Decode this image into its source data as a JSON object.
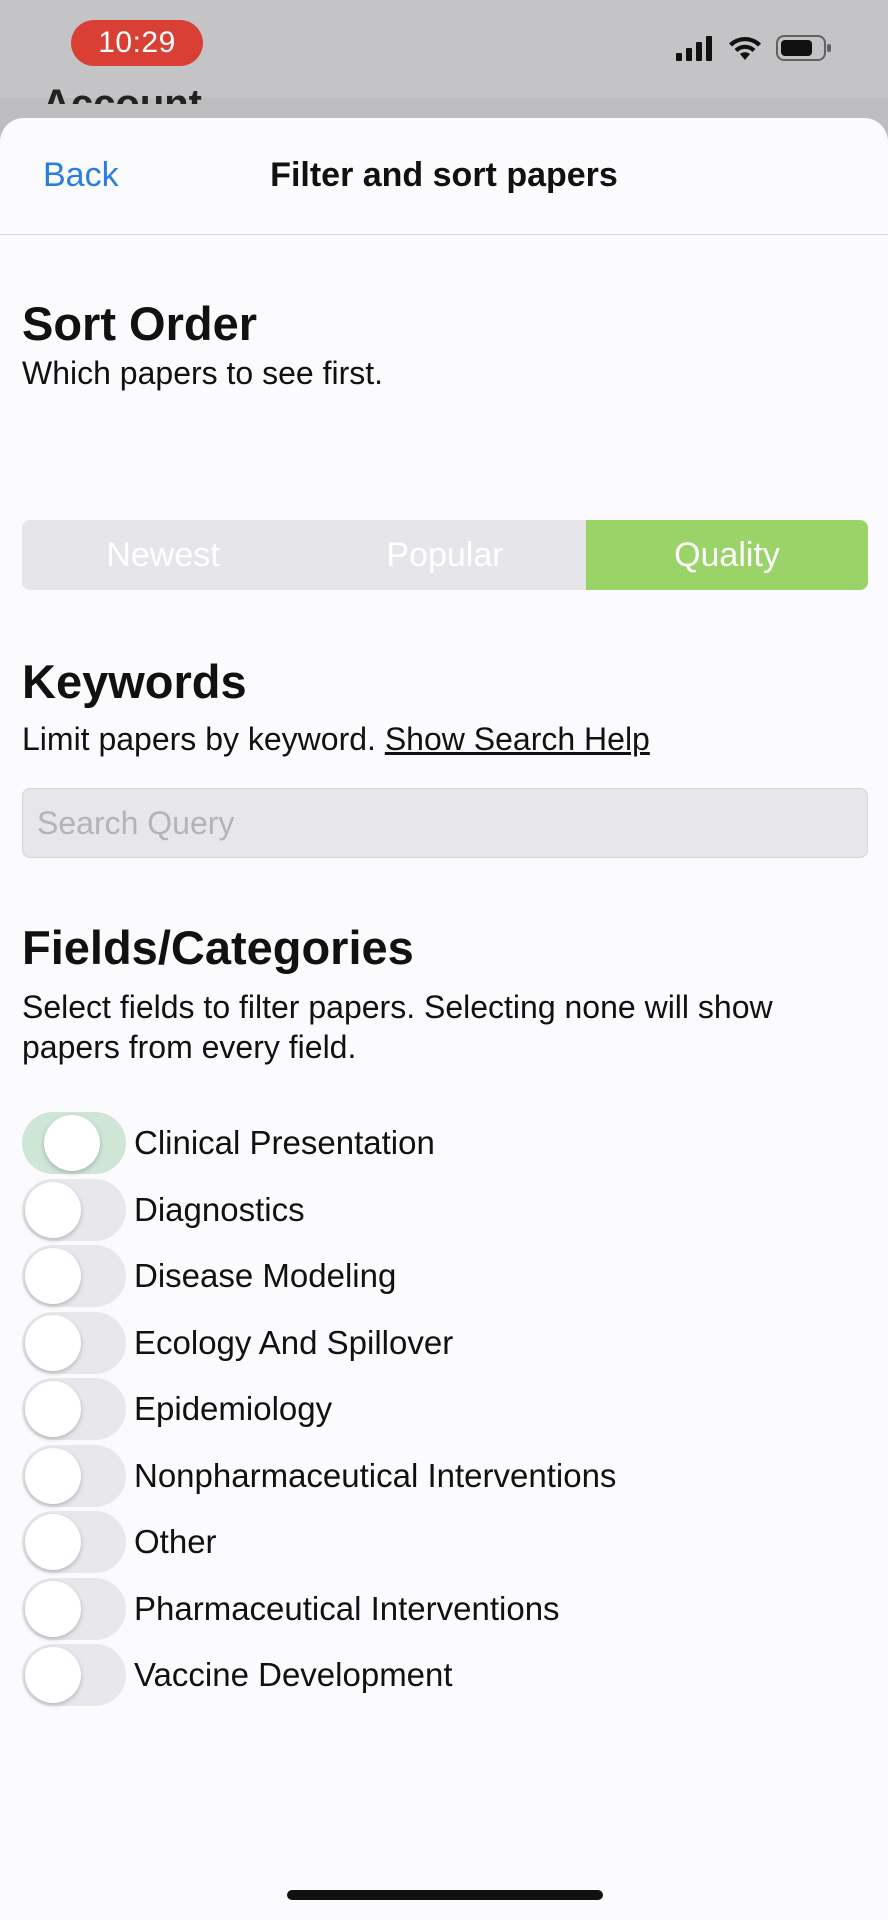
{
  "status_bar": {
    "time": "10:29",
    "icons": [
      "signal-bars-icon",
      "wifi-icon",
      "battery-icon"
    ],
    "time_pill_color": "#d93f35"
  },
  "behind_sheet_title": "Account",
  "nav": {
    "back_label": "Back",
    "title": "Filter and sort papers",
    "accent_color": "#2b7ede"
  },
  "sort_order": {
    "title": "Sort Order",
    "description": "Which papers to see first.",
    "options": [
      "Newest",
      "Popular",
      "Quality"
    ],
    "selected": "Quality",
    "selected_color": "#9ad368"
  },
  "keywords": {
    "title": "Keywords",
    "description": "Limit papers by keyword.",
    "help_link": "Show Search Help",
    "search_placeholder": "Search Query",
    "search_value": ""
  },
  "fields": {
    "title": "Fields/Categories",
    "description": "Select fields to filter papers. Selecting none will show papers from every field.",
    "items": [
      {
        "label": "Clinical Presentation",
        "on": true
      },
      {
        "label": "Diagnostics",
        "on": false
      },
      {
        "label": "Disease Modeling",
        "on": false
      },
      {
        "label": "Ecology And Spillover",
        "on": false
      },
      {
        "label": "Epidemiology",
        "on": false
      },
      {
        "label": "Nonpharmaceutical Interventions",
        "on": false
      },
      {
        "label": "Other",
        "on": false
      },
      {
        "label": "Pharmaceutical Interventions",
        "on": false
      },
      {
        "label": "Vaccine Development",
        "on": false
      }
    ]
  }
}
